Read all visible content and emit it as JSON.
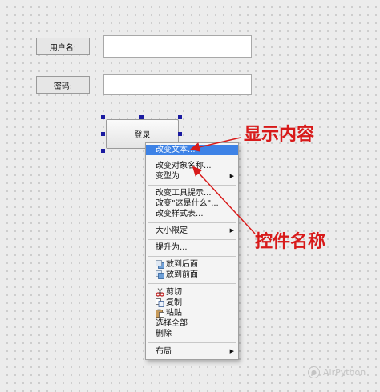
{
  "form": {
    "username_label": "用户名:",
    "password_label": "密码:",
    "login_button": "登录"
  },
  "menu": {
    "items": [
      {
        "label": "改变文本...",
        "highlighted": true
      },
      {
        "label": "改变对象名称..."
      },
      {
        "label": "变型为",
        "submenu": true
      },
      {
        "label": "改变工具提示..."
      },
      {
        "label": "改变\"这是什么\"..."
      },
      {
        "label": "改变样式表..."
      },
      {
        "label": "大小限定",
        "submenu": true
      },
      {
        "label": "提升为..."
      },
      {
        "label": "放到后面",
        "icon": "send-to-back-icon"
      },
      {
        "label": "放到前面",
        "icon": "bring-to-front-icon"
      },
      {
        "label": "剪切",
        "icon": "scissors-icon"
      },
      {
        "label": "复制",
        "icon": "copy-icon"
      },
      {
        "label": "粘贴",
        "icon": "paste-icon"
      },
      {
        "label": "选择全部"
      },
      {
        "label": "删除"
      },
      {
        "label": "布局",
        "submenu": true
      }
    ],
    "submenu_arrow": "▶"
  },
  "annotations": {
    "display_content": "显示内容",
    "control_name": "控件名称",
    "color": "#d81a1a"
  },
  "watermark": {
    "text": "AirPython",
    "icon": "wechat-icon"
  },
  "colors": {
    "highlight": "#3d82e6",
    "selection_handle": "#1a1aa0"
  }
}
